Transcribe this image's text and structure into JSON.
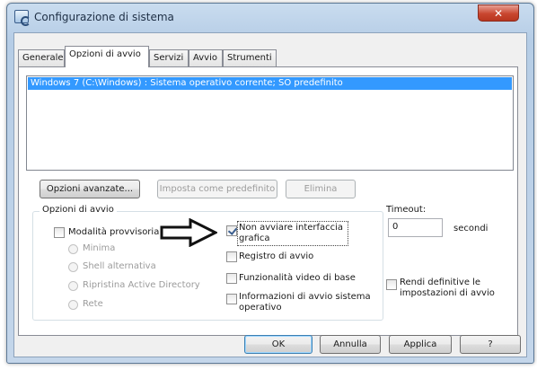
{
  "window": {
    "title": "Configurazione di sistema",
    "close_glyph": "✕"
  },
  "tabs": [
    {
      "label": "Generale",
      "active": false
    },
    {
      "label": "Opzioni di avvio",
      "active": true
    },
    {
      "label": "Servizi",
      "active": false
    },
    {
      "label": "Avvio",
      "active": false
    },
    {
      "label": "Strumenti",
      "active": false
    }
  ],
  "boot_list": {
    "entries": [
      "Windows 7 (C:\\Windows) : Sistema operativo corrente; SO predefinito"
    ],
    "selected_index": 0
  },
  "entry_buttons": {
    "advanced": "Opzioni avanzate...",
    "set_default": "Imposta come predefinito",
    "delete": "Elimina"
  },
  "boot_options": {
    "group_label": "Opzioni di avvio",
    "safe_boot": {
      "label": "Modalità provvisoria",
      "checked": false
    },
    "radios": [
      "Minima",
      "Shell alternativa",
      "Ripristina Active Directory",
      "Rete"
    ],
    "no_gui": {
      "label_line1": "Non avviare interfaccia",
      "label_line2": "grafica",
      "checked": true
    },
    "boot_log": {
      "label": "Registro di avvio",
      "checked": false
    },
    "base_video": {
      "label": "Funzionalità video di base",
      "checked": false
    },
    "os_info": {
      "label_line1": "Informazioni di avvio sistema",
      "label_line2": "operativo",
      "checked": false
    }
  },
  "timeout": {
    "label": "Timeout:",
    "value": "0",
    "unit": "secondi"
  },
  "make_permanent": {
    "label_line1": "Rendi definitive le",
    "label_line2": "impostazioni di avvio",
    "checked": false
  },
  "dialog_buttons": {
    "ok": "OK",
    "cancel": "Annulla",
    "apply": "Applica",
    "help": "?"
  },
  "icons": {
    "window_icon": "msconfig-icon",
    "annotation": "right-arrow-icon"
  },
  "colors": {
    "selection": "#3399ff",
    "close_button": "#c9462f",
    "frame": "#b6cde6"
  }
}
